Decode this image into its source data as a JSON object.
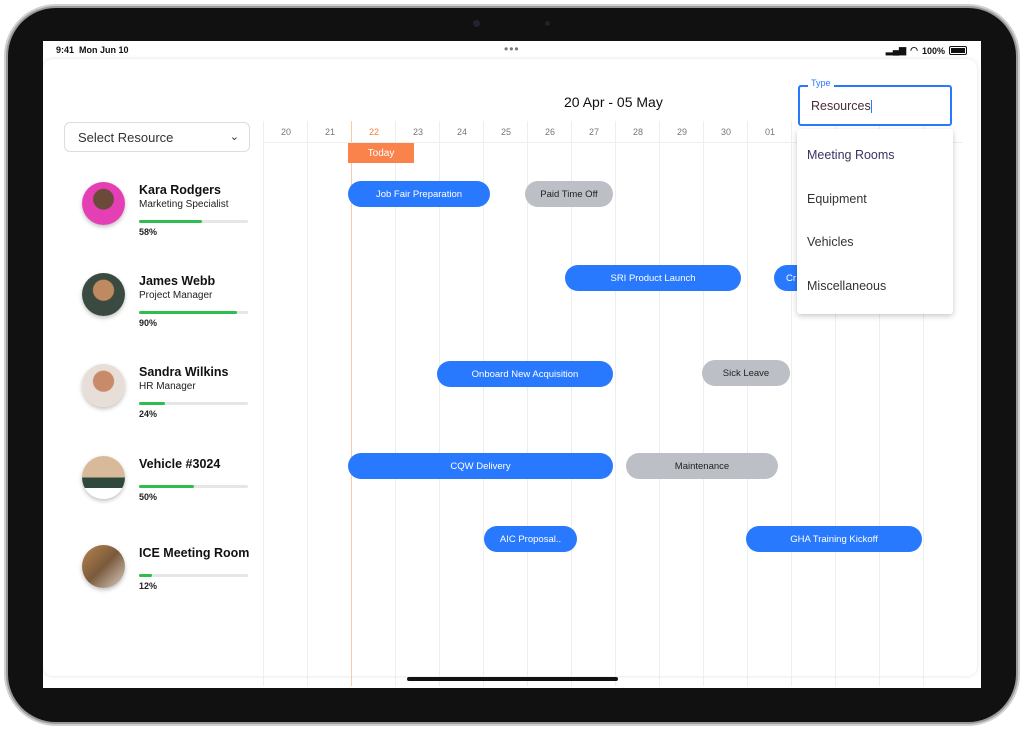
{
  "status_bar": {
    "time": "9:41",
    "date": "Mon Jun 10",
    "battery": "100%"
  },
  "header": {
    "date_range": "20 Apr - 05 May"
  },
  "resource_select": {
    "placeholder": "Select Resource"
  },
  "timeline": {
    "days": [
      "20",
      "21",
      "22",
      "23",
      "24",
      "25",
      "26",
      "27",
      "28",
      "29",
      "30",
      "01"
    ],
    "today_index": 2,
    "today_label": "Today",
    "colors": {
      "today": "#f9834a",
      "event": "#2979ff",
      "leave": "#bcc0c6",
      "progress": "#2ebd4e"
    }
  },
  "resources": [
    {
      "name": "Kara Rodgers",
      "role": "Marketing Specialist",
      "utilization": 58,
      "utilization_label": "58%",
      "events": [
        {
          "title": "Job Fair Preparation",
          "kind": "blue"
        },
        {
          "title": "Paid Time Off",
          "kind": "gray"
        }
      ]
    },
    {
      "name": "James Webb",
      "role": "Project Manager",
      "utilization": 90,
      "utilization_label": "90%",
      "events": [
        {
          "title": "SRI Product Launch",
          "kind": "blue"
        },
        {
          "title": "Cr",
          "kind": "blue"
        }
      ]
    },
    {
      "name": "Sandra Wilkins",
      "role": "HR Manager",
      "utilization": 24,
      "utilization_label": "24%",
      "events": [
        {
          "title": "Onboard New Acquisition",
          "kind": "blue"
        },
        {
          "title": "Sick Leave",
          "kind": "gray"
        }
      ]
    },
    {
      "name": "Vehicle #3024",
      "role": "",
      "utilization": 50,
      "utilization_label": "50%",
      "events": [
        {
          "title": "CQW Delivery",
          "kind": "blue"
        },
        {
          "title": "Maintenance",
          "kind": "gray"
        }
      ]
    },
    {
      "name": "ICE Meeting Room",
      "role": "",
      "utilization": 12,
      "utilization_label": "12%",
      "events": [
        {
          "title": "AIC Proposal..",
          "kind": "blue"
        },
        {
          "title": "GHA Training Kickoff",
          "kind": "blue"
        }
      ]
    }
  ],
  "type_dropdown": {
    "label": "Type",
    "value": "Resources",
    "options": [
      "Meeting Rooms",
      "Equipment",
      "Vehicles",
      "Miscellaneous"
    ]
  }
}
